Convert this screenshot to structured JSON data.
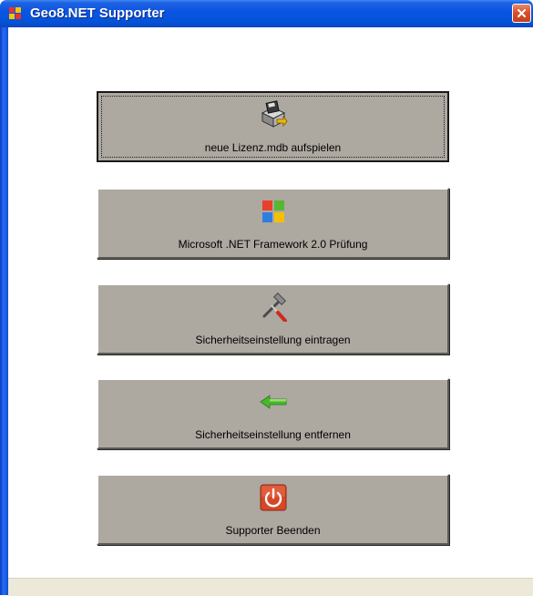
{
  "window": {
    "title": "Geo8.NET Supporter",
    "close_glyph": "✕",
    "app_icon": "geo8-app-icon",
    "accent": "#0a54e3"
  },
  "buttons": [
    {
      "label": "neue Lizenz.mdb aufspielen",
      "icon": "install-disk-icon",
      "focused": true
    },
    {
      "label": "Microsoft .NET Framework 2.0 Prüfung",
      "icon": "windows-logo-icon"
    },
    {
      "label": "Sicherheitseinstellung eintragen",
      "icon": "hammer-screwdriver-icon"
    },
    {
      "label": "Sicherheitseinstellung entfernen",
      "icon": "green-arrow-left-icon"
    },
    {
      "label": "Supporter Beenden",
      "icon": "power-icon"
    }
  ],
  "colors": {
    "button_face": "#ada8a0",
    "frame_blue": "#0a54e3",
    "close_red": "#d9502c"
  }
}
